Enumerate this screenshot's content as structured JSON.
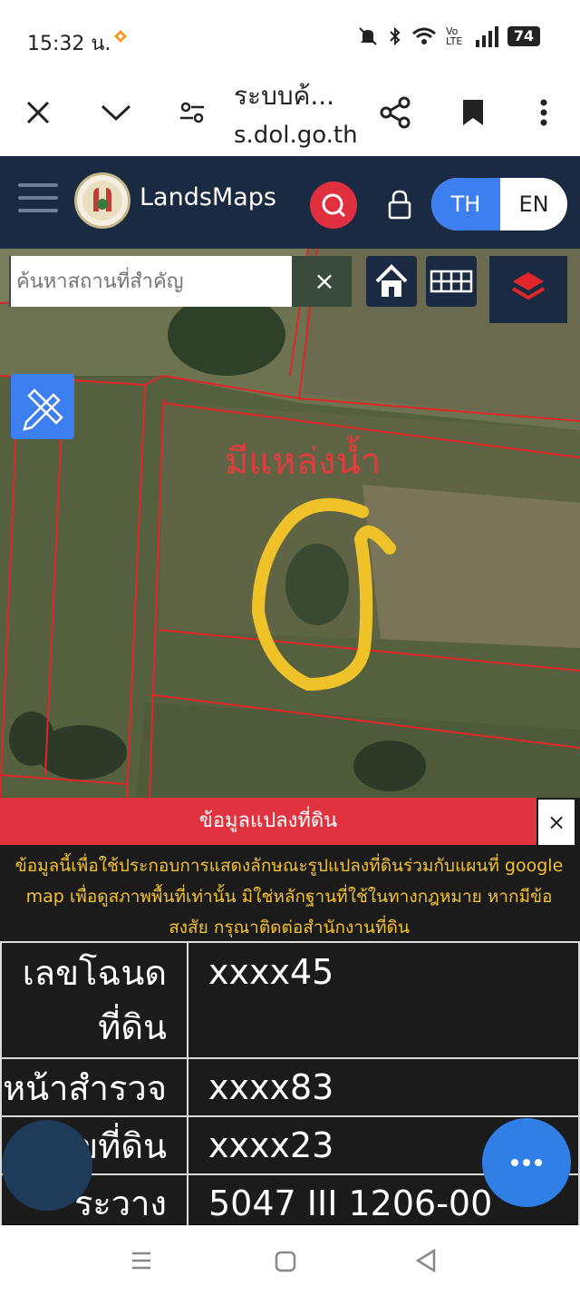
{
  "status_bar": {
    "time": "15:32 น.",
    "battery": "74",
    "network": "Vo LTE"
  },
  "browser": {
    "title": "ระบบค้...",
    "domain": "s.dol.go.th"
  },
  "header": {
    "app_name": "LandsMaps",
    "lang_th": "TH",
    "lang_en": "EN"
  },
  "map": {
    "search_placeholder": "ค้นหาสถานที่สำคัญ",
    "clear_label": "×",
    "annotation": "มีแหล่งน้ำ"
  },
  "panel": {
    "title": "ข้อมูลแปลงที่ดิน",
    "close_label": "×",
    "note": "ข้อมูลนี้เพื่อใช้ประกอบการแสดงลักษณะรูปแปลงที่ดินร่วมกับแผนที่ google map เพื่อดูสภาพพื้นที่เท่านั้น มิใช่หลักฐานที่ใช้ในทางกฎหมาย หากมีข้อสงสัย กรุณาติดต่อสำนักงานที่ดิน",
    "rows": [
      {
        "label": "เลขโฉนดที่ดิน",
        "value": "xxxx45"
      },
      {
        "label": "หน้าสำรวจ",
        "value": "xxxx83"
      },
      {
        "label": "เลขที่ดิน",
        "value": "xxxx23"
      },
      {
        "label": "ระวาง",
        "value": "5047 III 1206-00"
      }
    ]
  },
  "colors": {
    "header_bg": "#1a2a42",
    "accent_red": "#e0323f",
    "accent_blue": "#3d7ef0",
    "note_yellow": "#f3c22f"
  }
}
